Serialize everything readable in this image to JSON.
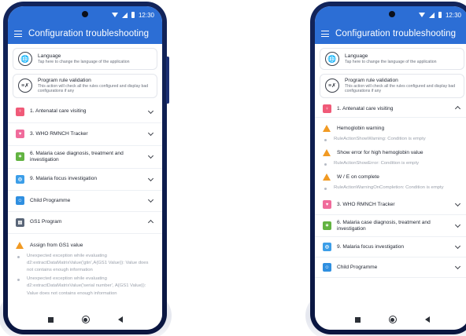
{
  "app": {
    "status_time": "12:30",
    "title": "Configuration troubleshooting"
  },
  "cards": {
    "language": {
      "title": "Language",
      "subtitle": "Tap here to change the language of the application",
      "icon": "globe-icon"
    },
    "validation": {
      "title": "Program rule validation",
      "subtitle": "This action will check all the rules configured and display bad configurations if any",
      "icon": "rule-check-icon"
    }
  },
  "left": {
    "programs": [
      {
        "label": "1. Antenatal care visiting",
        "color": "#f05a78",
        "icon": "pregnant-woman-icon",
        "expanded": false
      },
      {
        "label": "3. WHO RMNCH Tracker",
        "color": "#f06b9b",
        "icon": "mother-child-icon",
        "expanded": false
      },
      {
        "label": "6. Malaria case diagnosis, treatment and investigation",
        "color": "#62b341",
        "icon": "malaria-icon",
        "expanded": false
      },
      {
        "label": "9. Malaria focus investigation",
        "color": "#3c9ee8",
        "icon": "focus-investigation-icon",
        "expanded": false
      },
      {
        "label": "Child Programme",
        "color": "#2f8fe0",
        "icon": "child-icon",
        "expanded": false
      },
      {
        "label": "GS1 Program",
        "color": "#5a6678",
        "icon": "package-icon",
        "expanded": true
      }
    ],
    "warnings": [
      {
        "title": "Assign from GS1 value",
        "messages": [
          "Unexpected exception while evaluating d2:extractDataMatrixValue('gtin',A{GS1 Value}): Value does not contains enough information",
          "Unexpected exception while evaluating d2:extractDataMatrixValue('serial number', A{GS1 Value}): Value does not contains enough information"
        ]
      }
    ]
  },
  "right": {
    "expanded_program": {
      "label": "1. Antenatal care visiting",
      "color": "#f05a78",
      "icon": "pregnant-woman-icon"
    },
    "warnings": [
      {
        "title": "Hemoglobin warning",
        "message": "RuleActionShowWarning: Condition is empty"
      },
      {
        "title": "Show error for high hemoglobin value",
        "message": "RuleActionShowError: Condition is empty"
      },
      {
        "title": "W / E on complete",
        "message": "RuleActionWarningOnCompletion: Condition is empty"
      }
    ],
    "programs": [
      {
        "label": "3. WHO RMNCH Tracker",
        "color": "#f06b9b",
        "icon": "mother-child-icon"
      },
      {
        "label": "6. Malaria case diagnosis, treatment and investigation",
        "color": "#62b341",
        "icon": "malaria-icon"
      },
      {
        "label": "9. Malaria focus investigation",
        "color": "#3c9ee8",
        "icon": "focus-investigation-icon"
      },
      {
        "label": "Child Programme",
        "color": "#2f8fe0",
        "icon": "child-icon"
      }
    ]
  }
}
